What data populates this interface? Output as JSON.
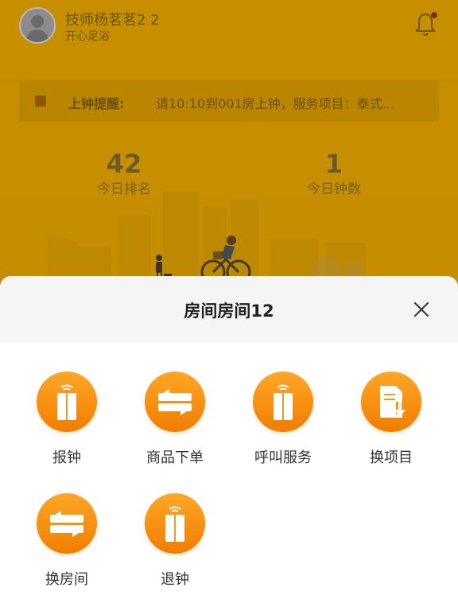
{
  "profile": {
    "technician_name": "技师杨茗茗2 2",
    "store_name": "开心足浴"
  },
  "notice": {
    "label": "上钟提醒:",
    "text": "请10:10到001房上钟，服务项目：泰式..."
  },
  "stats": {
    "rank_value": "42",
    "rank_label": "今日排名",
    "clock_value": "1",
    "clock_label": "今日钟数"
  },
  "sheet": {
    "title": "房间房间12",
    "actions": [
      {
        "label": "报钟",
        "icon": "card-icon"
      },
      {
        "label": "商品下单",
        "icon": "ticket-icon"
      },
      {
        "label": "呼叫服务",
        "icon": "card-icon"
      },
      {
        "label": "换项目",
        "icon": "document-download-icon"
      },
      {
        "label": "换房间",
        "icon": "ticket-icon"
      },
      {
        "label": "退钟",
        "icon": "card-icon"
      }
    ]
  },
  "colors": {
    "accent": "#f58a07",
    "accent_light": "#ffa726",
    "notification_dot": "#e53935"
  }
}
